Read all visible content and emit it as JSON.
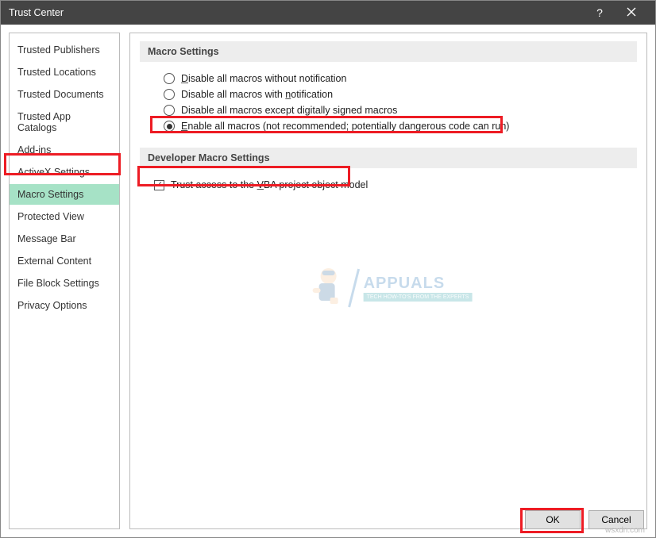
{
  "window": {
    "title": "Trust Center"
  },
  "sidebar": {
    "items": [
      {
        "label": "Trusted Publishers"
      },
      {
        "label": "Trusted Locations"
      },
      {
        "label": "Trusted Documents"
      },
      {
        "label": "Trusted App Catalogs"
      },
      {
        "label": "Add-ins"
      },
      {
        "label": "ActiveX Settings"
      },
      {
        "label": "Macro Settings"
      },
      {
        "label": "Protected View"
      },
      {
        "label": "Message Bar"
      },
      {
        "label": "External Content"
      },
      {
        "label": "File Block Settings"
      },
      {
        "label": "Privacy Options"
      }
    ],
    "selected_index": 6
  },
  "sections": {
    "macro": {
      "heading": "Macro Settings",
      "options": [
        {
          "pre": "",
          "u": "D",
          "rest": "isable all macros without notification",
          "selected": false
        },
        {
          "pre": "Disable all macros with ",
          "u": "n",
          "rest": "otification",
          "selected": false
        },
        {
          "pre": "Disable all macros except di",
          "u": "g",
          "rest": "itally signed macros",
          "selected": false
        },
        {
          "pre": "",
          "u": "E",
          "rest": "nable all macros (not recommended; potentially dangerous code can run)",
          "selected": true
        }
      ]
    },
    "dev": {
      "heading": "Developer Macro Settings",
      "checkbox": {
        "pre": "Trust access to the ",
        "u": "V",
        "rest": "BA project object model",
        "checked": true
      }
    }
  },
  "footer": {
    "ok": "OK",
    "cancel": "Cancel"
  },
  "watermark": {
    "brand": "APPUALS",
    "tag": "TECH HOW-TO'S FROM THE EXPERTS"
  },
  "attribution": "wsxdn.com"
}
